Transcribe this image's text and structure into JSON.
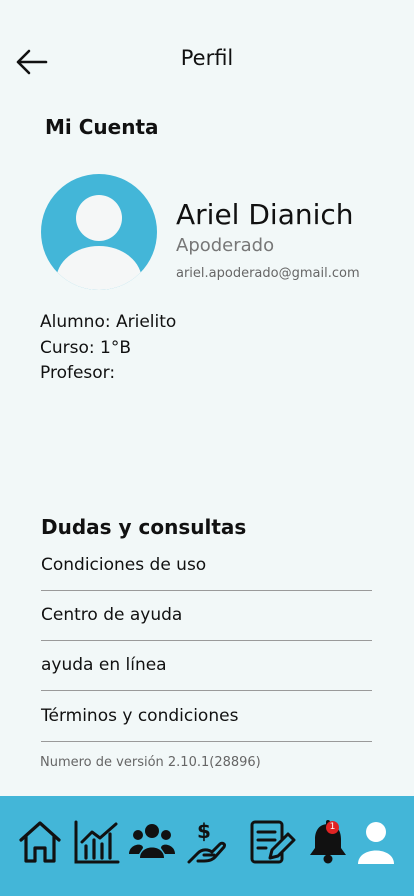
{
  "header": {
    "title": "Perfil",
    "back_icon": "arrow-left-icon"
  },
  "account": {
    "section_title": "Mi Cuenta",
    "avatar_color": "#43b6d8",
    "name": "Ariel Dianich",
    "role": "Apoderado",
    "email": "ariel.apoderado@gmail.com",
    "student": "Alumno: Arielito",
    "course": "Curso: 1°B",
    "teacher": "Profesor:"
  },
  "help": {
    "section_title": "Dudas y consultas",
    "links": [
      {
        "label": "Condiciones de uso"
      },
      {
        "label": "Centro de ayuda"
      },
      {
        "label": "ayuda en línea"
      },
      {
        "label": "Términos y condiciones"
      }
    ],
    "version": "Numero de versión 2.10.1(28896)"
  },
  "bottom_nav": {
    "background": "#43b6d8",
    "items": [
      {
        "icon": "home-icon"
      },
      {
        "icon": "bar-chart-icon"
      },
      {
        "icon": "users-icon"
      },
      {
        "icon": "payment-hand-icon"
      },
      {
        "icon": "edit-document-icon"
      },
      {
        "icon": "bell-icon",
        "badge": "1"
      },
      {
        "icon": "user-icon"
      }
    ]
  }
}
